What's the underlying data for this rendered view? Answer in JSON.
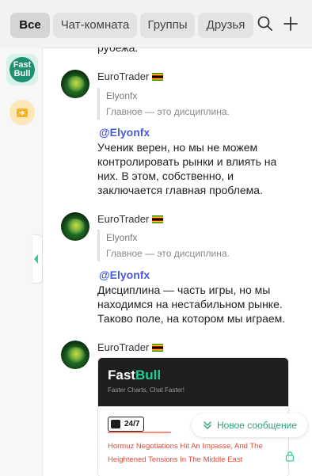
{
  "tabs": [
    {
      "label": "Все",
      "active": true
    },
    {
      "label": "Чат-комната",
      "active": false
    },
    {
      "label": "Группы",
      "active": false
    },
    {
      "label": "Друзья",
      "active": false
    }
  ],
  "icons": {
    "search": "search-icon",
    "add": "plus-icon",
    "lock": "lock-icon",
    "chevron": "double-chevron-down-icon",
    "collapse": "chevron-left-icon"
  },
  "rail": {
    "items": [
      {
        "name": "FastBull",
        "logo_line1": "Fast",
        "logo_line2": "Bull"
      },
      {
        "name": "folder"
      }
    ]
  },
  "colors": {
    "accent": "#1f8f71",
    "mention": "#4a5cd6",
    "news_red": "#e04b3c"
  },
  "chat": {
    "top_fragment": "рубежа.",
    "messages": [
      {
        "author": "EuroTrader",
        "quote_name": "Elyonfx",
        "quote_text": "Главное — это дисциплина.",
        "mention": "@Elyonfx",
        "text": "Ученик верен, но мы не можем контролировать рынки и влиять на них. В этом, собственно, и заключается главная проблема."
      },
      {
        "author": "EuroTrader",
        "quote_name": "Elyonfx",
        "quote_text": "Главное — это дисциплина.",
        "mention": "@Elyonfx",
        "text": "Дисциплина — часть игры, но мы находимся на нестабильном рынке. Таково поле, на котором мы играем."
      },
      {
        "author": "EuroTrader",
        "card": {
          "logo_part1": "Fast",
          "logo_part2": "Bull",
          "tagline": "Faster Charts, Chat Faster!",
          "badge": "24/7",
          "headline": "Hormuz Negotiations Hit An Impasse, And The Heightened Tensions In The Middle East"
        }
      }
    ]
  },
  "new_message_label": "Новое сообщение"
}
